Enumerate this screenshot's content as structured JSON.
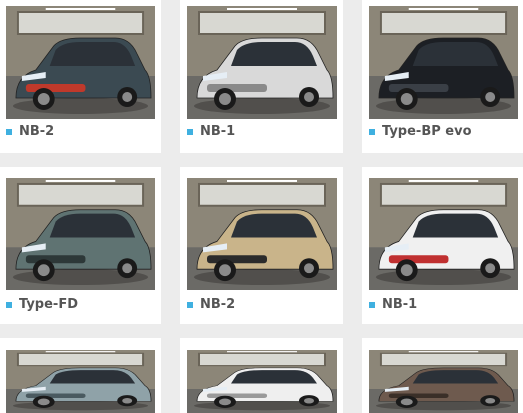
{
  "gallery": {
    "items": [
      {
        "label": "NB-2",
        "car_color": "#3b4a52",
        "accent": "#c0392b"
      },
      {
        "label": "NB-1",
        "car_color": "#d9d9d9",
        "accent": "#8a8a8a"
      },
      {
        "label": "Type-BP evo",
        "car_color": "#1c1f24",
        "accent": "#3a3f46"
      },
      {
        "label": "Type-FD",
        "car_color": "#5f7372",
        "accent": "#2d3838"
      },
      {
        "label": "NB-2",
        "car_color": "#c9b48a",
        "accent": "#2b2b2b"
      },
      {
        "label": "NB-1",
        "car_color": "#f0f0f0",
        "accent": "#c03030"
      },
      {
        "label": "",
        "car_color": "#8fa2a8",
        "accent": "#4a5a60"
      },
      {
        "label": "",
        "car_color": "#efefef",
        "accent": "#9a9a9a"
      },
      {
        "label": "",
        "car_color": "#6e5a4e",
        "accent": "#3a2f28"
      }
    ]
  },
  "colors": {
    "page_bg": "#ececec",
    "card_bg": "#ffffff",
    "bullet": "#3fb0e0",
    "label_text": "#555555"
  },
  "icons": {
    "bullet": "square-bullet-icon"
  }
}
